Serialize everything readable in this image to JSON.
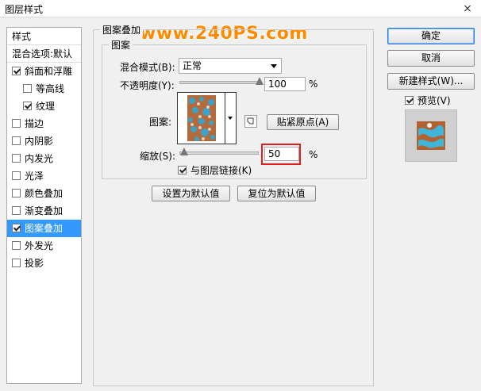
{
  "window": {
    "title": "图层样式",
    "close_icon": "×"
  },
  "watermark": "www.240PS.com",
  "stylelist": {
    "header": "样式",
    "blend_default": "混合选项:默认",
    "items": [
      {
        "label": "斜面和浮雕",
        "checked": true
      },
      {
        "label": "等高线",
        "checked": false
      },
      {
        "label": "纹理",
        "checked": true
      },
      {
        "label": "描边",
        "checked": false
      },
      {
        "label": "内阴影",
        "checked": false
      },
      {
        "label": "内发光",
        "checked": false
      },
      {
        "label": "光泽",
        "checked": false
      },
      {
        "label": "颜色叠加",
        "checked": false
      },
      {
        "label": "渐变叠加",
        "checked": false
      },
      {
        "label": "图案叠加",
        "checked": true
      },
      {
        "label": "外发光",
        "checked": false
      },
      {
        "label": "投影",
        "checked": false
      }
    ]
  },
  "panel": {
    "outer_legend": "图案叠加",
    "inner_legend": "图案",
    "blend_mode_label": "混合模式(B):",
    "blend_mode_value": "正常",
    "opacity_label": "不透明度(Y):",
    "opacity_value": "100",
    "opacity_level": 100,
    "percent": "%",
    "pattern_label": "图案:",
    "snap_button": "贴紧原点(A)",
    "scale_label": "缩放(S):",
    "scale_value": "50",
    "scale_level": 50,
    "link_label": "与图层链接(K)",
    "link_checked": true,
    "set_default": "设置为默认值",
    "reset_default": "复位为默认值"
  },
  "actions": {
    "ok": "确定",
    "cancel": "取消",
    "new_style": "新建样式(W)...",
    "preview_label": "预览(V)",
    "preview_checked": true
  }
}
